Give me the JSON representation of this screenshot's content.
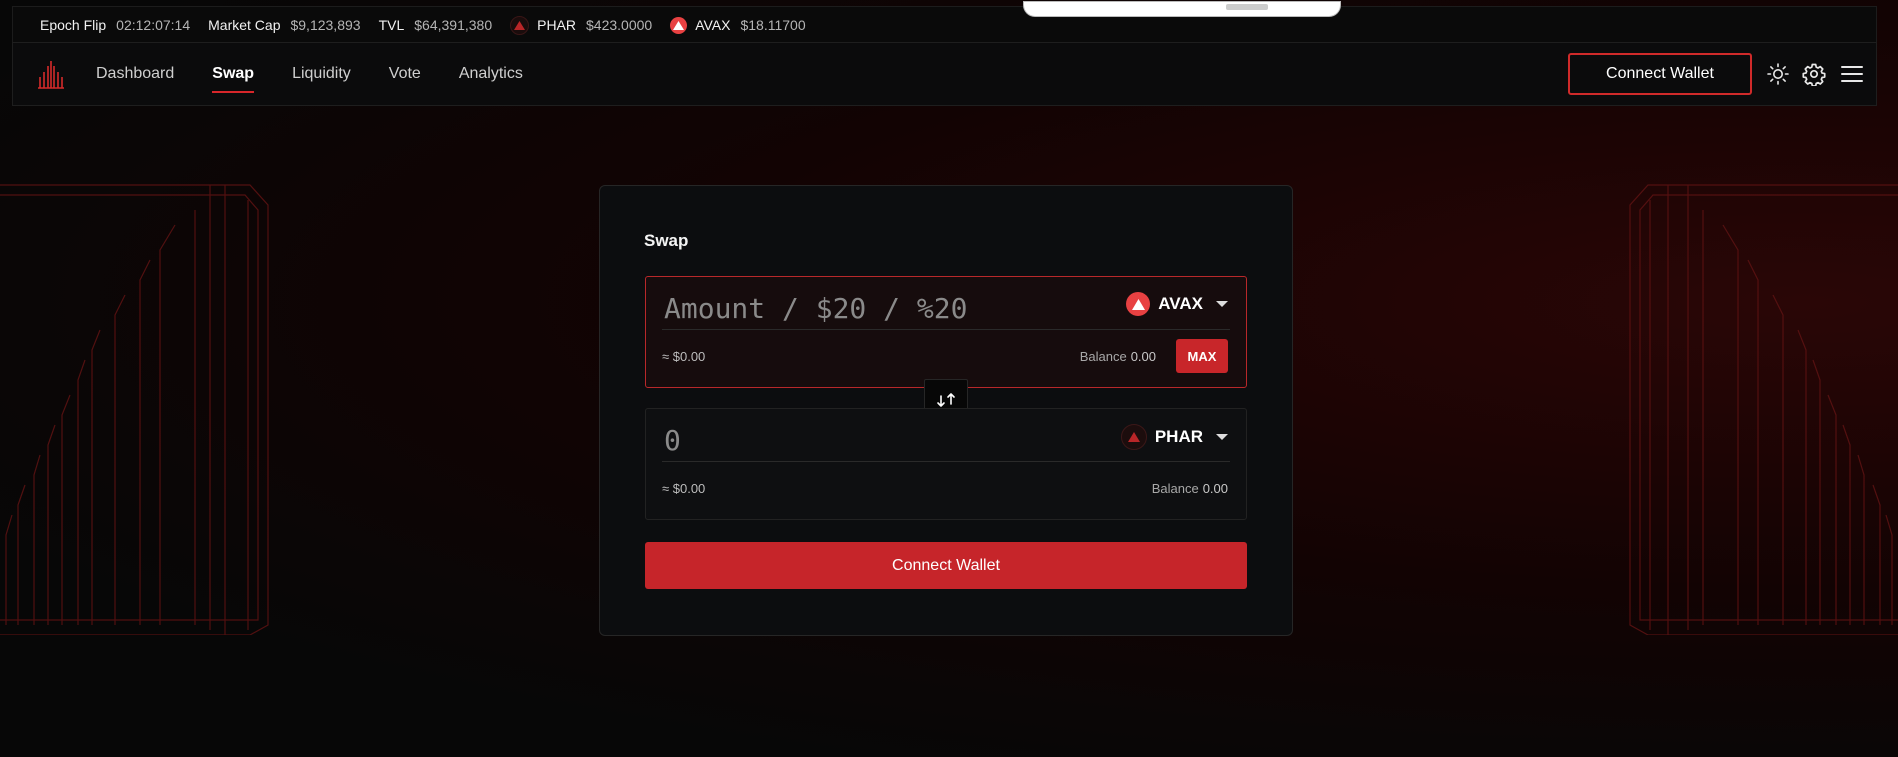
{
  "ticker": {
    "epoch_label": "Epoch Flip",
    "epoch_value": "02:12:07:14",
    "mcap_label": "Market Cap",
    "mcap_value": "$9,123,893",
    "tvl_label": "TVL",
    "tvl_value": "$64,391,380",
    "phar_label": "PHAR",
    "phar_value": "$423.0000",
    "avax_label": "AVAX",
    "avax_value": "$18.11700"
  },
  "nav": {
    "links": [
      "Dashboard",
      "Swap",
      "Liquidity",
      "Vote",
      "Analytics"
    ],
    "active": "Swap",
    "connect_label": "Connect Wallet",
    "icons": [
      "sun-icon",
      "gear-icon",
      "menu-icon"
    ]
  },
  "swap": {
    "title": "Swap",
    "from": {
      "placeholder": "Amount / $20 / %20",
      "token": "AVAX",
      "usd": "≈ $0.00",
      "balance_label": "Balance",
      "balance_value": "0.00",
      "max_label": "MAX"
    },
    "to": {
      "placeholder": "0",
      "token": "PHAR",
      "usd": "≈ $0.00",
      "balance_label": "Balance",
      "balance_value": "0.00"
    },
    "connect_label": "Connect Wallet"
  },
  "colors": {
    "accent": "#c8262a",
    "background": "#0a0a0a",
    "card": "#0c0d0f"
  }
}
